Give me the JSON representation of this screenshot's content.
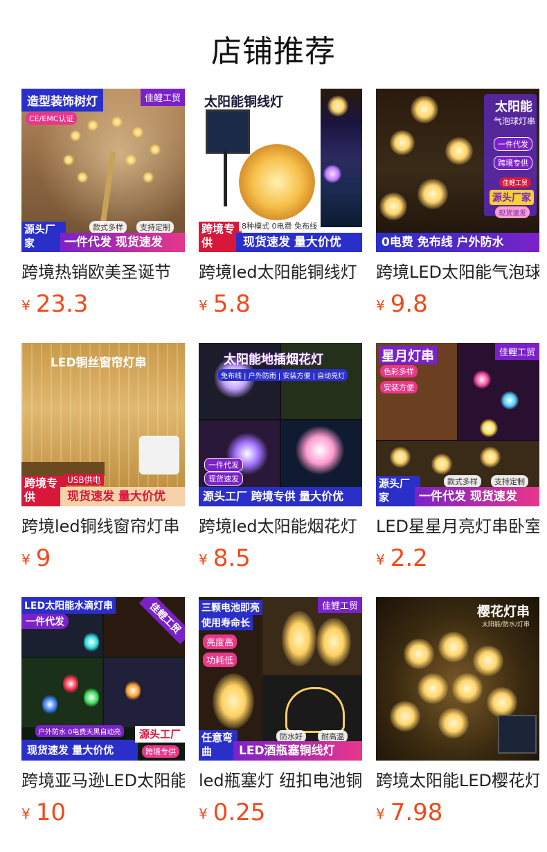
{
  "page": {
    "title": "店铺推荐"
  },
  "currency_symbol": "¥",
  "products": [
    {
      "name": "跨境热销欧美圣诞节",
      "price": "23.3",
      "image_text": {
        "headline": "造型装饰树灯",
        "brand": "佳鲤工贸",
        "cert": "CE/EMC认证",
        "tags": [
          "款式多样",
          "支持定制"
        ],
        "corner": "源头厂家",
        "footer": "一件代发 现货速发"
      }
    },
    {
      "name": "跨境led太阳能铜线灯",
      "price": "5.8",
      "image_text": {
        "headline": "太阳能铜线灯",
        "sub": "8种模式  0电费 免布线",
        "corner": "跨境专供",
        "footer": "现货速发 量大价优"
      }
    },
    {
      "name": "跨境LED太阳能气泡球灯",
      "price": "9.8",
      "image_text": {
        "headline": "太阳能",
        "sub": "气泡球灯串",
        "tags": [
          "一件代发",
          "跨境专供"
        ],
        "badge": "源头厂家",
        "badge_top": "佳鲤工贸",
        "badge_bottom": "现货速发",
        "footer": "0电费 免布线 户外防水"
      }
    },
    {
      "name": "跨境led铜线窗帘灯串",
      "price": "9",
      "image_text": {
        "headline": "LED铜丝窗帘灯串",
        "sub": "USB供电",
        "corner": "跨境专供",
        "footer": "现货速发 量大价优"
      }
    },
    {
      "name": "跨境led太阳能烟花灯",
      "price": "8.5",
      "image_text": {
        "headline": "太阳能地插烟花灯",
        "sub": "免布线 | 户外防雨 | 安装方便 | 自动亮灯",
        "tags": [
          "一件代发",
          "现货速发"
        ],
        "footer": "源头工厂 跨境专供 量大价优"
      }
    },
    {
      "name": "LED星星月亮灯串卧室",
      "price": "2.2",
      "image_text": {
        "headline": "星月灯串",
        "brand": "佳鲤工贸",
        "tags": [
          "色彩多样",
          "安装方便"
        ],
        "tags2": [
          "款式多样",
          "支持定制"
        ],
        "corner": "源头厂家",
        "footer": "一件代发 现货速发"
      }
    },
    {
      "name": "跨境亚马逊LED太阳能",
      "price": "10",
      "image_text": {
        "headline": "LED太阳能水滴灯串",
        "brand": "佳鲤工贸",
        "tag": "一件代发",
        "sub": "户外防水 0电费天黑自动亮",
        "corner": "源头工厂",
        "corner_sub": "跨境专供",
        "footer": "现货速发 量大价优"
      }
    },
    {
      "name": "led瓶塞灯 纽扣电池铜线灯",
      "price": "0.25",
      "image_text": {
        "headline": "三颗电池即亮",
        "headline2": "使用寿命长",
        "brand": "佳鲤工贸",
        "tags": [
          "亮度高",
          "功耗低"
        ],
        "tags2": [
          "防水好",
          "耐高温"
        ],
        "corner": "任意弯曲",
        "footer": "LED酒瓶塞铜线灯"
      }
    },
    {
      "name": "跨境太阳能LED樱花灯串",
      "price": "7.98",
      "image_text": {
        "headline": "樱花灯串",
        "sub": "太阳能/防水/灯串"
      }
    }
  ],
  "colors": {
    "price": "#f04a1a",
    "banner_blue": "#2b2fc9",
    "banner_purple": "#7a22c8",
    "banner_pink": "#e8378a",
    "corner_red": "#d8183a"
  }
}
